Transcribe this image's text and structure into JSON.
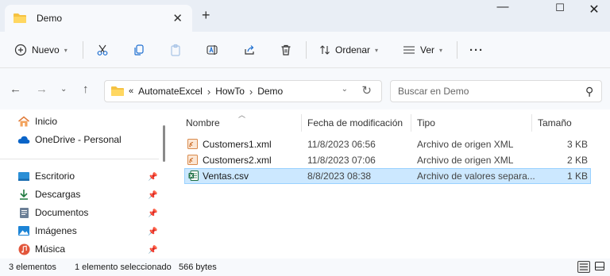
{
  "tab": {
    "title": "Demo"
  },
  "toolbar": {
    "new_label": "Nuevo",
    "sort_label": "Ordenar",
    "view_label": "Ver"
  },
  "address": {
    "crumbs": [
      "AutomateExcel",
      "HowTo",
      "Demo"
    ],
    "overflow": "«"
  },
  "search": {
    "placeholder": "Buscar en Demo"
  },
  "sidebar": {
    "items": [
      {
        "label": "Inicio",
        "icon": "home-icon",
        "pinned": false
      },
      {
        "label": "OneDrive - Personal",
        "icon": "cloud-icon",
        "pinned": false
      },
      {
        "label": "Escritorio",
        "icon": "desktop-icon",
        "pinned": true
      },
      {
        "label": "Descargas",
        "icon": "download-icon",
        "pinned": true
      },
      {
        "label": "Documentos",
        "icon": "document-icon",
        "pinned": true
      },
      {
        "label": "Imágenes",
        "icon": "pictures-icon",
        "pinned": true
      },
      {
        "label": "Música",
        "icon": "music-icon",
        "pinned": true
      }
    ]
  },
  "columns": {
    "name": "Nombre",
    "modified": "Fecha de modificación",
    "type": "Tipo",
    "size": "Tamaño"
  },
  "files": [
    {
      "name": "Customers1.xml",
      "modified": "11/8/2023 06:56",
      "type": "Archivo de origen XML",
      "size": "3 KB",
      "icon": "xml-file-icon",
      "selected": false
    },
    {
      "name": "Customers2.xml",
      "modified": "11/8/2023 07:06",
      "type": "Archivo de origen XML",
      "size": "2 KB",
      "icon": "xml-file-icon",
      "selected": false
    },
    {
      "name": "Ventas.csv",
      "modified": "8/8/2023 08:38",
      "type": "Archivo de valores separa...",
      "size": "1 KB",
      "icon": "excel-csv-icon",
      "selected": true
    }
  ],
  "status": {
    "count": "3 elementos",
    "selection": "1 elemento seleccionado",
    "size": "566 bytes"
  },
  "colors": {
    "selection_bg": "#cce8ff",
    "selection_border": "#99d1ff",
    "folder_yellow": "#f5c242",
    "accent_blue": "#0067c0"
  }
}
